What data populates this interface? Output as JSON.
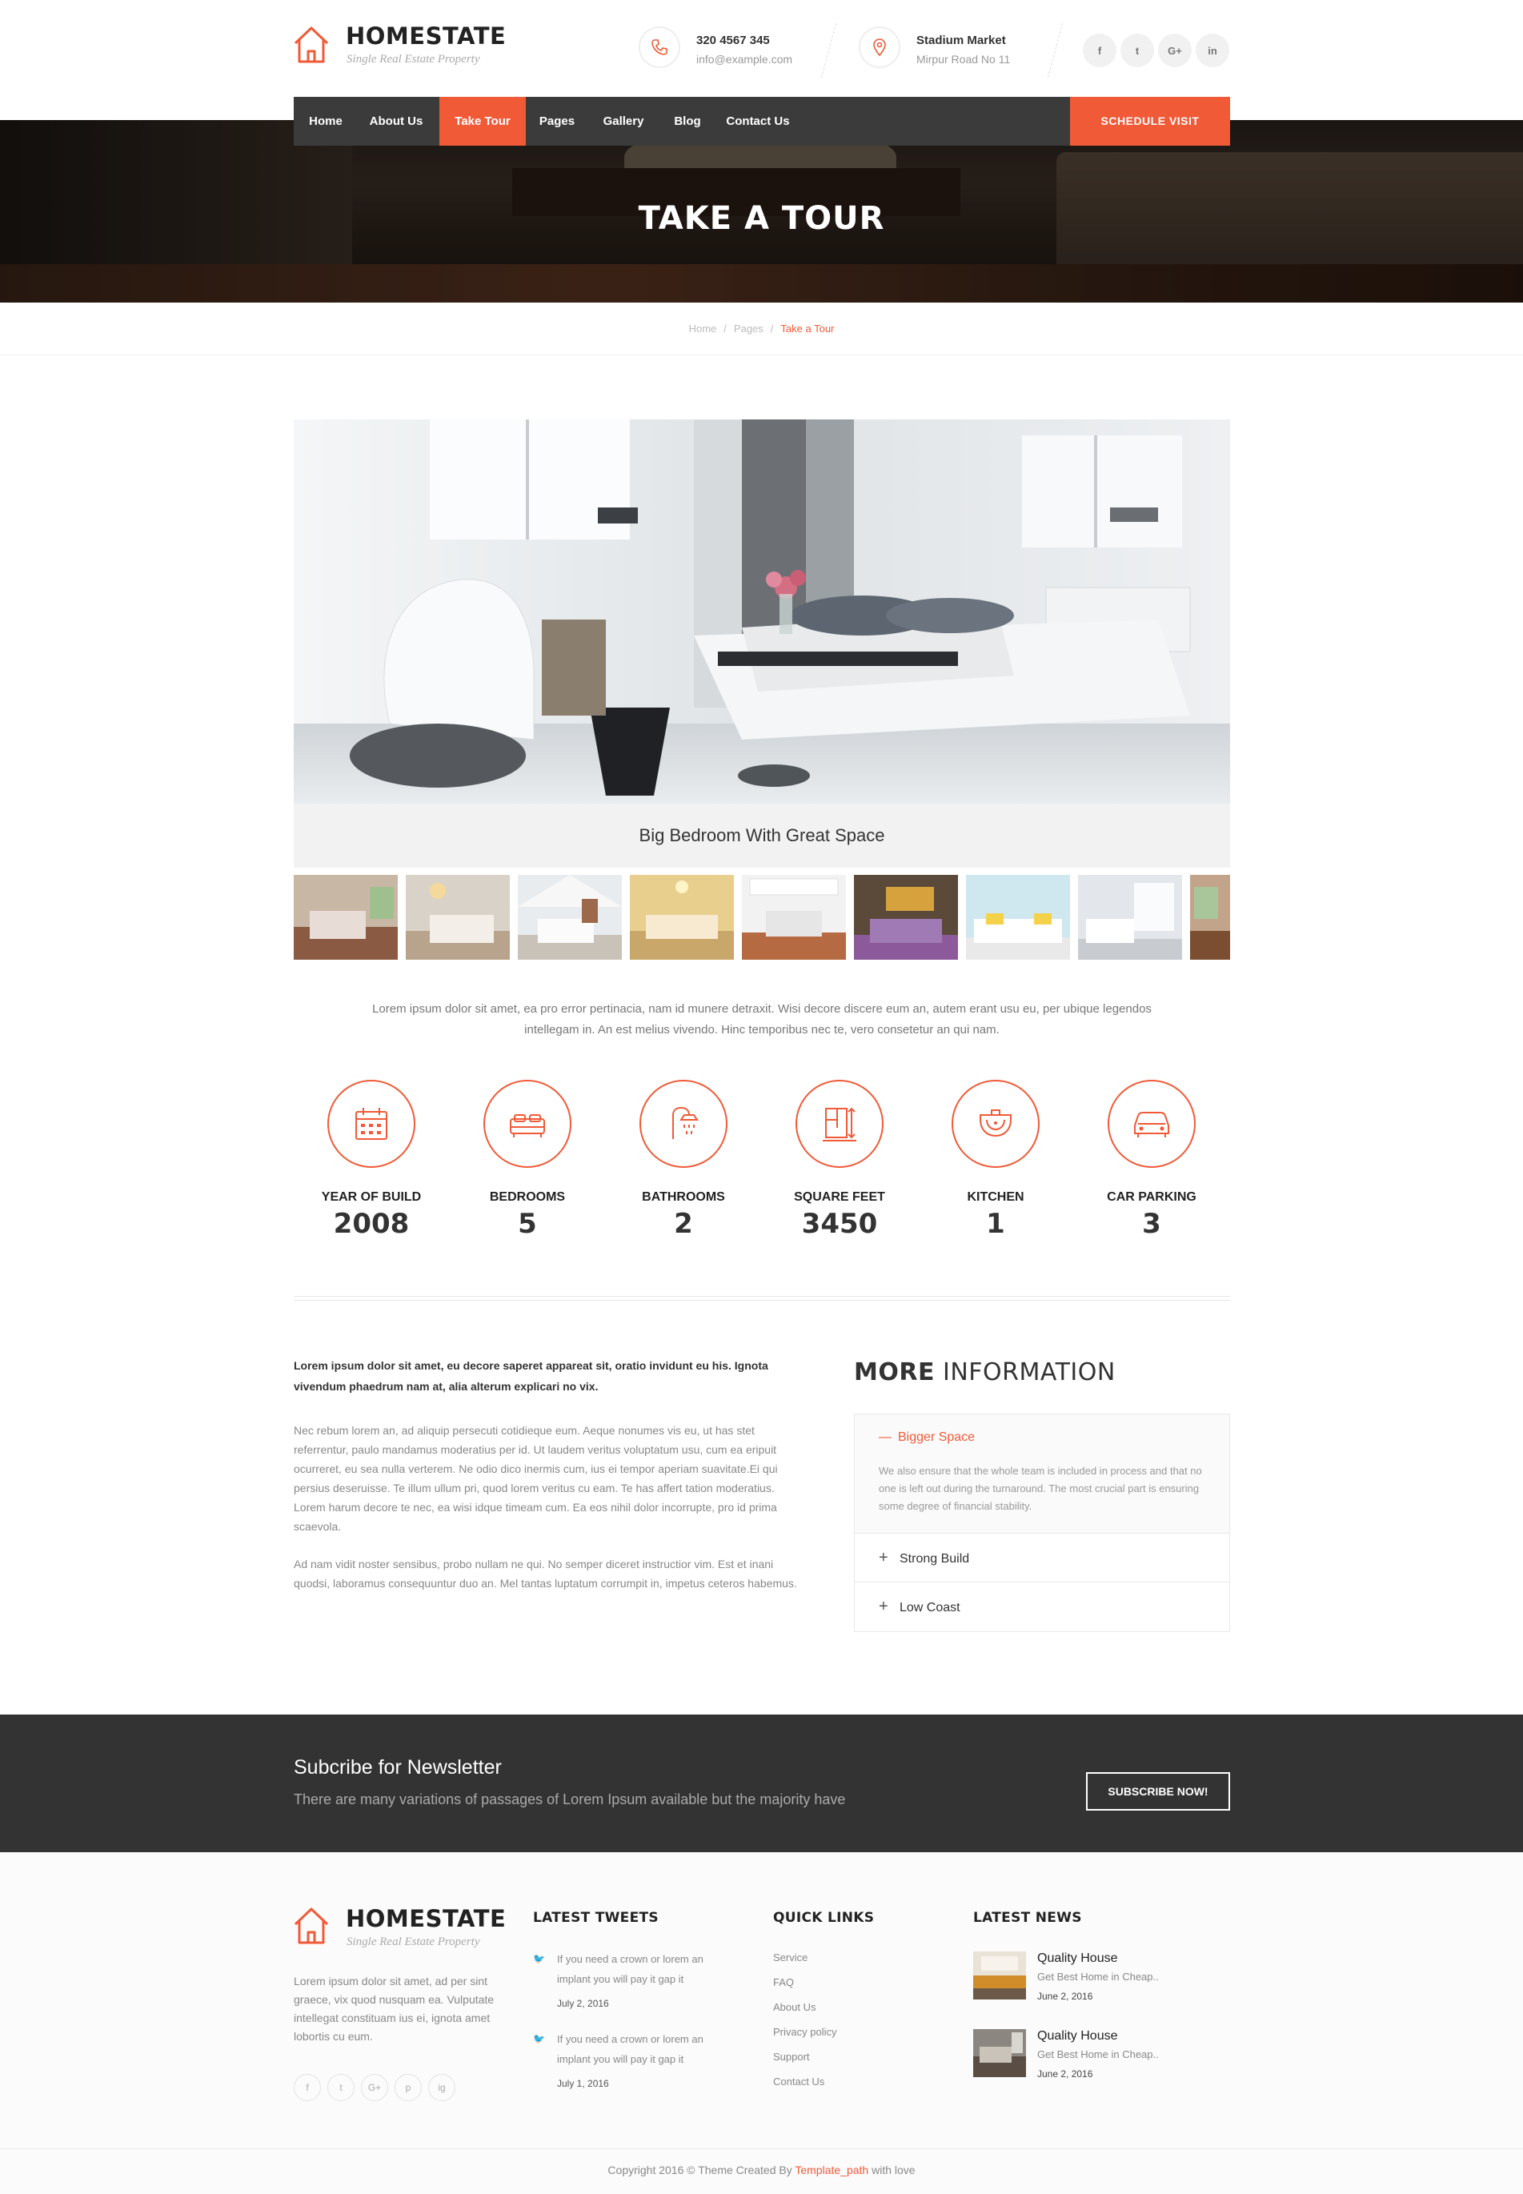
{
  "brand": {
    "name": "HOMESTATE",
    "tagline": "Single Real Estate Property",
    "accent_color": "#f05a37",
    "dark_color": "#3b3b3b"
  },
  "header": {
    "phone": "320 4567 345",
    "email": "info@example.com",
    "address_title": "Stadium Market",
    "address_line": "Mirpur Road No 11",
    "social": [
      "f",
      "t",
      "G+",
      "in"
    ]
  },
  "nav": {
    "items": [
      "Home",
      "About Us",
      "Take Tour",
      "Pages",
      "Gallery",
      "Blog",
      "Contact Us"
    ],
    "active": "Take Tour",
    "cta": "SCHEDULE VISIT"
  },
  "hero": {
    "title": "TAKE A TOUR"
  },
  "breadcrumb": {
    "items": [
      "Home",
      "Pages"
    ],
    "current": "Take a Tour"
  },
  "gallery": {
    "caption": "Big Bedroom With Great Space",
    "thumbnail_count": 9
  },
  "intro": {
    "text": "Lorem ipsum dolor sit amet, ea pro error pertinacia, nam id munere detraxit. Wisi decore discere eum an, autem erant usu eu, per ubique legendos intellegam in. An est melius vivendo. Hinc temporibus nec te, vero consetetur an qui nam."
  },
  "features": [
    {
      "label": "YEAR OF BUILD",
      "value": "2008",
      "icon": "calendar-icon"
    },
    {
      "label": "BEDROOMS",
      "value": "5",
      "icon": "bed-icon"
    },
    {
      "label": "BATHROOMS",
      "value": "2",
      "icon": "shower-icon"
    },
    {
      "label": "SQUARE FEET",
      "value": "3450",
      "icon": "floorplan-icon"
    },
    {
      "label": "KITCHEN",
      "value": "1",
      "icon": "sink-icon"
    },
    {
      "label": "CAR PARKING",
      "value": "3",
      "icon": "car-icon"
    }
  ],
  "content": {
    "lead": "Lorem ipsum dolor sit amet, eu decore saperet appareat sit, oratio invidunt eu his. Ignota vivendum phaedrum nam at, alia alterum explicari no vix.",
    "para1": "Nec rebum lorem an, ad aliquip persecuti cotidieque eum. Aeque nonumes vis eu, ut has stet referrentur, paulo mandamus moderatius per id. Ut laudem veritus voluptatum usu, cum ea eripuit ocurreret, eu sea nulla verterem. Ne odio dico inermis cum, ius ei tempor aperiam suavitate.Ei qui persius deseruisse. Te illum ullum pri, quod lorem veritus cu eam. Te has affert tation moderatius. Lorem harum decore te nec, ea wisi idque timeam cum. Ea eos nihil dolor incorrupte, pro id prima scaevola.",
    "para2": "Ad nam vidit noster sensibus, probo nullam ne qui. No semper diceret instructior vim. Est et inani quodsi, laboramus consequuntur duo an. Mel tantas luptatum corrumpit in, impetus ceteros habemus."
  },
  "more_info": {
    "title_bold": "MORE",
    "title_rest": "INFORMATION",
    "open_item": {
      "title": "Bigger Space",
      "body": "We also ensure that the whole team is included in process and that no one is left out during the turnaround. The most crucial part is ensuring some degree of financial stability."
    },
    "items": [
      "Strong Build",
      "Low Coast"
    ]
  },
  "newsletter": {
    "title": "Subcribe for Newsletter",
    "subtitle": "There are many variations of passages of Lorem Ipsum available but the majority have",
    "button": "SUBSCRIBE NOW!"
  },
  "footer": {
    "about": "Lorem ipsum dolor sit amet, ad per sint graece, vix quod nusquam ea. Vulputate intellegat constituam ius ei, ignota amet lobortis cu eum.",
    "social": [
      "f",
      "t",
      "G+",
      "p",
      "ig"
    ],
    "tweets_title": "LATEST TWEETS",
    "tweets": [
      {
        "text": "If you need a crown or lorem an implant you will pay it gap it",
        "date": "July 2, 2016"
      },
      {
        "text": "If you need a crown or lorem an implant you will pay it gap it",
        "date": "July 1, 2016"
      }
    ],
    "links_title": "QUICK LINKS",
    "links": [
      "Service",
      "FAQ",
      "About Us",
      "Privacy policy",
      "Support",
      "Contact Us"
    ],
    "news_title": "LATEST NEWS",
    "news": [
      {
        "title": "Quality House",
        "sub": "Get Best Home in Cheap..",
        "date": "June 2, 2016"
      },
      {
        "title": "Quality House",
        "sub": "Get Best Home in Cheap..",
        "date": "June 2, 2016"
      }
    ],
    "copyright_pre": "Copyright 2016 © Theme Created By",
    "copyright_link": "Template_path",
    "copyright_post": "with love"
  }
}
